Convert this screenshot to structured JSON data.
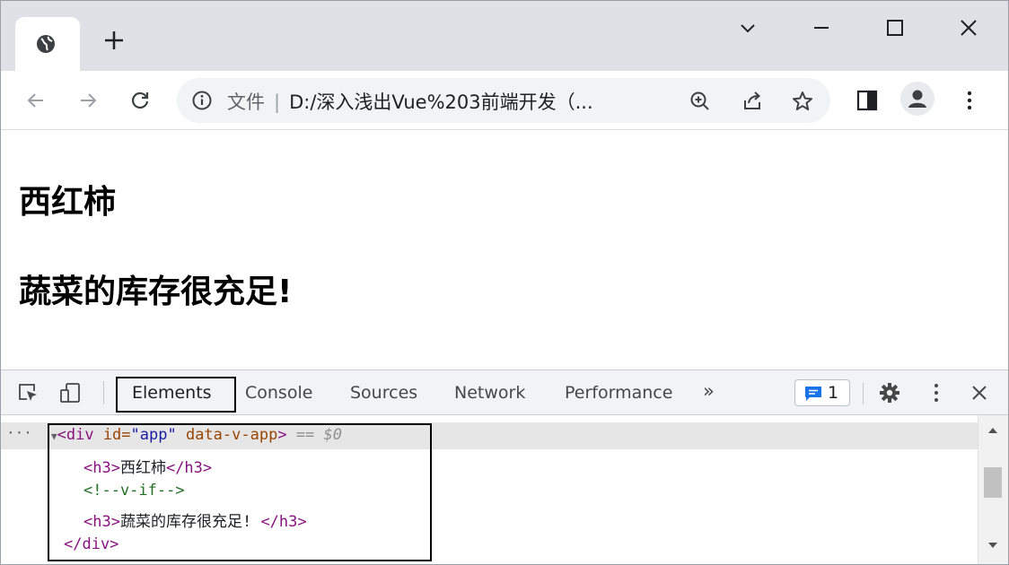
{
  "browser": {
    "new_tab_label": "+",
    "omnibox": {
      "scheme_label": "文件",
      "separator": "|",
      "url": "D:/深入浅出Vue%203前端开发（..."
    }
  },
  "page": {
    "heading_1": "西红柿",
    "heading_2": "蔬菜的库存很充足!"
  },
  "devtools": {
    "tabs": [
      "Elements",
      "Console",
      "Sources",
      "Network",
      "Performance"
    ],
    "more_tabs": "»",
    "active_tab": "Elements",
    "issues_count": "1",
    "dom": {
      "gutter_dots": "···",
      "root_open_tag": "<div",
      "root_attr_id_name": " id=",
      "root_attr_id_value": "\"app\"",
      "root_attr_extra": " data-v-app",
      "root_open_close": ">",
      "selected_marker": " == $0",
      "child1_open": "<h3>",
      "child1_text": "西红柿",
      "child1_close": "</h3>",
      "comment": "<!--v-if-->",
      "child2_open": "<h3>",
      "child2_text": "蔬菜的库存很充足!",
      "child2_close": " </h3>",
      "root_close_tag": "</div>"
    }
  },
  "colors": {
    "tabstrip_bg": "#dee1e6",
    "devtools_tag": "#881280",
    "devtools_attr": "#994500",
    "devtools_value": "#1a1aa6",
    "devtools_comment": "#236e25",
    "issues_blue": "#1a73e8"
  },
  "icons": {
    "tab_favicon": "globe-icon",
    "back": "arrow-left-icon",
    "forward": "arrow-right-icon",
    "reload": "reload-icon",
    "info": "info-icon",
    "zoom": "zoom-in-icon",
    "share": "share-icon",
    "bookmark": "star-icon",
    "side_panel": "side-panel-icon",
    "profile": "avatar-icon",
    "menu": "kebab-menu-icon"
  }
}
